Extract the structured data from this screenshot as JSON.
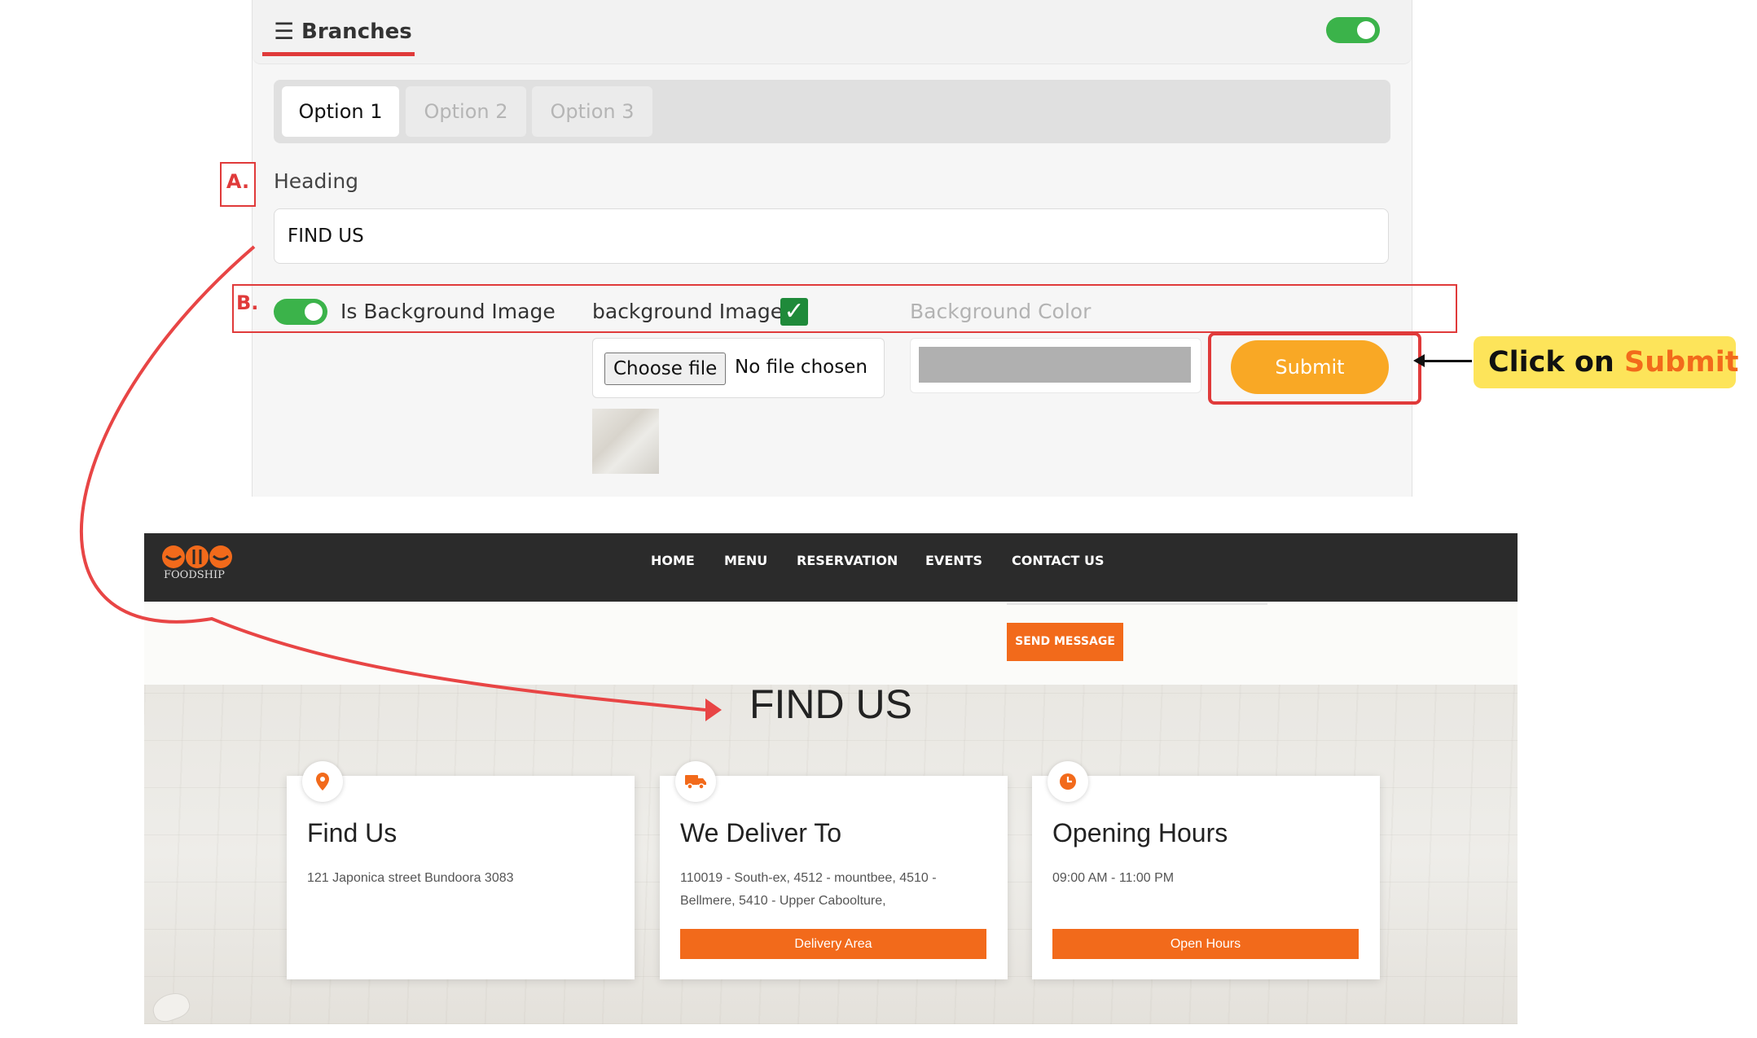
{
  "admin": {
    "title": "Branches",
    "tabs": [
      "Option 1",
      "Option 2",
      "Option 3"
    ],
    "marker_a": "A.",
    "marker_b": "B.",
    "heading_label": "Heading",
    "heading_value": "FIND US",
    "is_background_image_label": "Is Background Image",
    "background_image_label": "background Image",
    "background_color_label": "Background Color",
    "choose_file_label": "Choose file",
    "no_file_label": "No file chosen",
    "submit_label": "Submit"
  },
  "callout": {
    "prefix": "Click on ",
    "accent": "Submit"
  },
  "site": {
    "logo_text": "FOODSHIP",
    "nav": [
      "HOME",
      "MENU",
      "RESERVATION",
      "EVENTS",
      "CONTACT US"
    ],
    "send_message": "SEND MESSAGE",
    "section_title": "FIND US",
    "cards": [
      {
        "icon": "map-pin-icon",
        "title": "Find Us",
        "text": "121 Japonica street Bundoora 3083",
        "button": ""
      },
      {
        "icon": "truck-icon",
        "title": "We Deliver To",
        "text": "110019 - South-ex, 4512 - mountbee, 4510 - Bellmere, 5410 - Upper Caboolture,",
        "button": "Delivery Area"
      },
      {
        "icon": "clock-icon",
        "title": "Opening Hours",
        "text": "09:00 AM - 11:00 PM",
        "button": "Open Hours"
      }
    ]
  },
  "colors": {
    "accent_orange": "#f26a1b",
    "submit_yellow": "#f9a825",
    "toggle_green": "#3bb34a",
    "annotation_red": "#e03a3a",
    "callout_yellow": "#fde45a"
  }
}
